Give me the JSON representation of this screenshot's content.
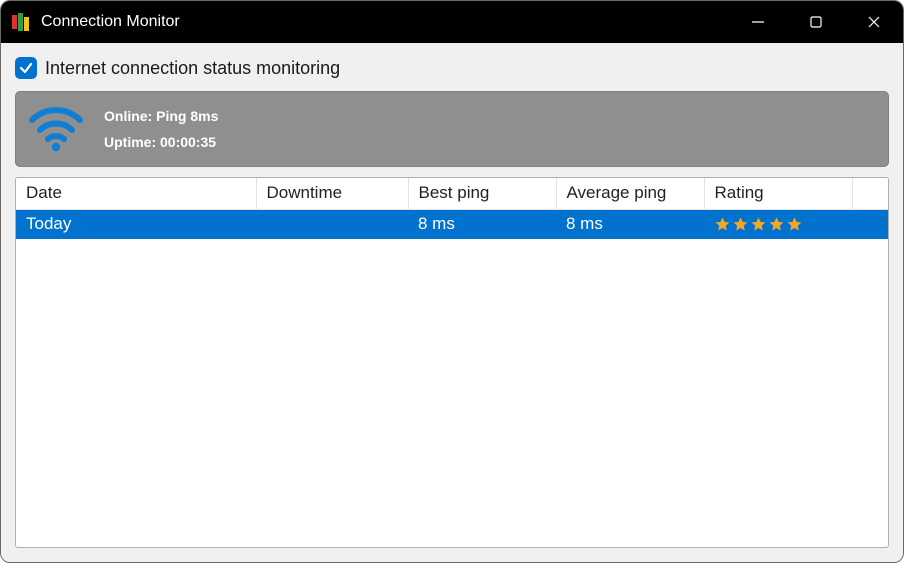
{
  "window": {
    "title": "Connection Monitor"
  },
  "checkbox": {
    "checked": true,
    "label": "Internet connection status monitoring"
  },
  "status": {
    "line1": "Online: Ping 8ms",
    "line2": "Uptime: 00:00:35"
  },
  "table": {
    "headers": {
      "date": "Date",
      "downtime": "Downtime",
      "best_ping": "Best ping",
      "avg_ping": "Average ping",
      "rating": "Rating"
    },
    "row": {
      "date": "Today",
      "downtime": "",
      "best_ping": "8 ms",
      "avg_ping": "8 ms",
      "rating_stars": 5
    }
  },
  "colors": {
    "accent": "#0173cf",
    "star": "#f5a623",
    "wifi": "#0f7fd6"
  }
}
